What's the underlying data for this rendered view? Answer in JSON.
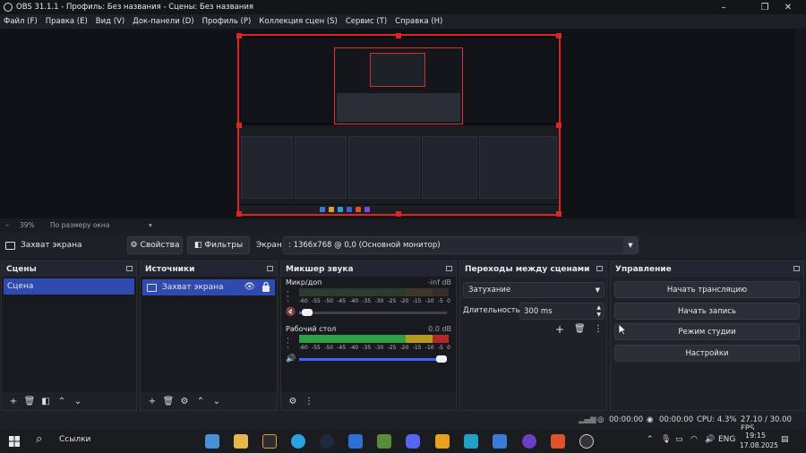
{
  "window": {
    "title": "OBS 31.1.1 - Профиль: Без названия - Сцены: Без названия",
    "controls": [
      "–",
      "❐",
      "✕"
    ]
  },
  "menu": [
    "Файл (F)",
    "Правка (E)",
    "Вид (V)",
    "Док-панели (D)",
    "Профиль (P)",
    "Коллекция сцен (S)",
    "Сервис (T)",
    "Справка (H)"
  ],
  "zoom": {
    "minus": "–",
    "value": "39%",
    "fit_mode": "По размеру окна",
    "chevron": "▾"
  },
  "source_toolbar": {
    "source_name": "Захват экрана",
    "properties_label": "Свойства",
    "filters_label": "Фильтры",
    "screen_label": "Экран",
    "screen_value": ": 1366x768 @ 0,0 (Основной монитор)"
  },
  "docks": {
    "scenes": {
      "title": "Сцены",
      "items": [
        "Сцена"
      ]
    },
    "sources": {
      "title": "Источники",
      "items": [
        "Захват экрана"
      ]
    },
    "mixer": {
      "title": "Микшер звука",
      "channels": [
        {
          "name": "Микр/доп",
          "db": "-inf dB",
          "muted": true,
          "volume": 0.02
        },
        {
          "name": "Рабочий стол",
          "db": "0.0 dB",
          "muted": false,
          "volume": 1.0
        }
      ],
      "scale": [
        "-60",
        "-55",
        "-50",
        "-45",
        "-40",
        "-35",
        "-30",
        "-25",
        "-20",
        "-15",
        "-10",
        "-5",
        "0"
      ]
    },
    "transitions": {
      "title": "Переходы между сценами",
      "transition": "Затухание",
      "duration_label": "Длительность",
      "duration_value": "300 ms"
    },
    "controls": {
      "title": "Управление",
      "buttons": [
        "Начать трансляцию",
        "Начать запись",
        "Режим студии",
        "Настройки"
      ]
    }
  },
  "status": {
    "stream_time": "00:00:00",
    "record_time": "00:00:00",
    "cpu": "CPU: 4.3%",
    "fps": "27.10 / 30.00 FPS"
  },
  "taskbar": {
    "search_label": "Ссылки",
    "language": "ENG",
    "time": "19:15",
    "date": "17.08.2025"
  },
  "colors": {
    "accent": "#2f4bb0",
    "selection_red": "#e02424",
    "meter_green": "#2ea043",
    "meter_yellow": "#b59a1f",
    "meter_red": "#b02a2a",
    "slider_blue": "#3b63ff"
  }
}
